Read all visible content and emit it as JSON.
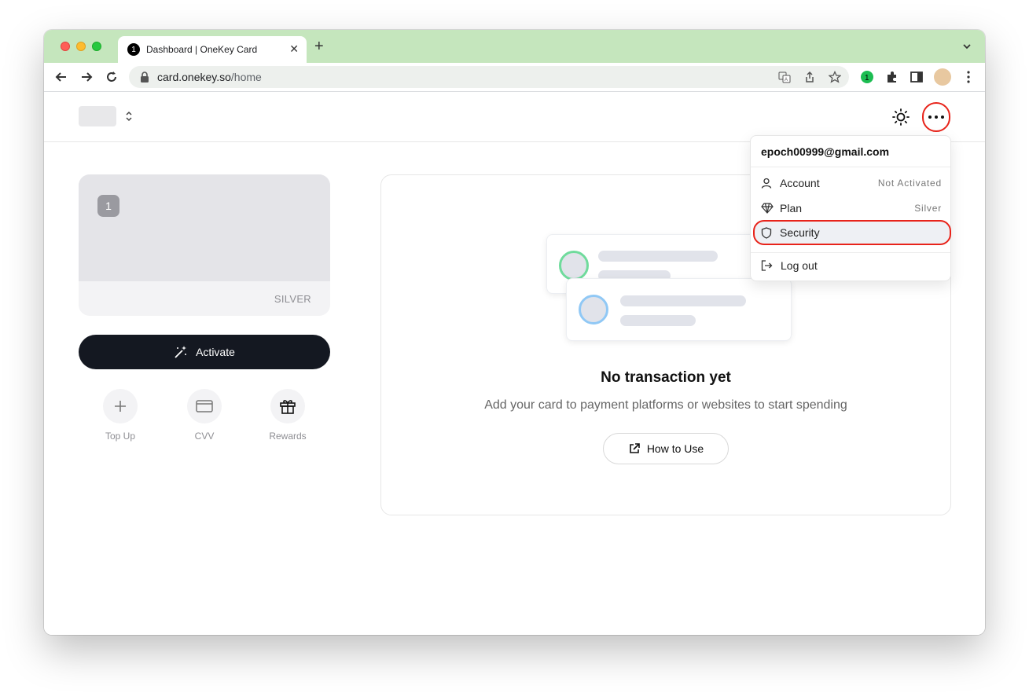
{
  "browser": {
    "tab_title": "Dashboard | OneKey Card",
    "url_host": "card.onekey.so",
    "url_path": "/home"
  },
  "card": {
    "tier": "SILVER"
  },
  "actions": {
    "activate_label": "Activate",
    "quick": [
      {
        "label": "Top Up",
        "icon": "plus-icon"
      },
      {
        "label": "CVV",
        "icon": "card-icon"
      },
      {
        "label": "Rewards",
        "icon": "gift-icon"
      }
    ]
  },
  "empty_state": {
    "title": "No transaction yet",
    "subtitle": "Add your card to payment platforms or websites to start spending",
    "button_label": "How to Use"
  },
  "menu": {
    "email": "epoch00999@gmail.com",
    "items": [
      {
        "label": "Account",
        "value": "Not Activated",
        "icon": "user-icon"
      },
      {
        "label": "Plan",
        "value": "Silver",
        "icon": "diamond-icon"
      },
      {
        "label": "Security",
        "value": "",
        "icon": "shield-icon"
      },
      {
        "label": "Log out",
        "value": "",
        "icon": "logout-icon"
      }
    ]
  },
  "colors": {
    "tabstrip": "#c5e6bd",
    "highlight": "#e8231a",
    "primary_button": "#141821"
  }
}
